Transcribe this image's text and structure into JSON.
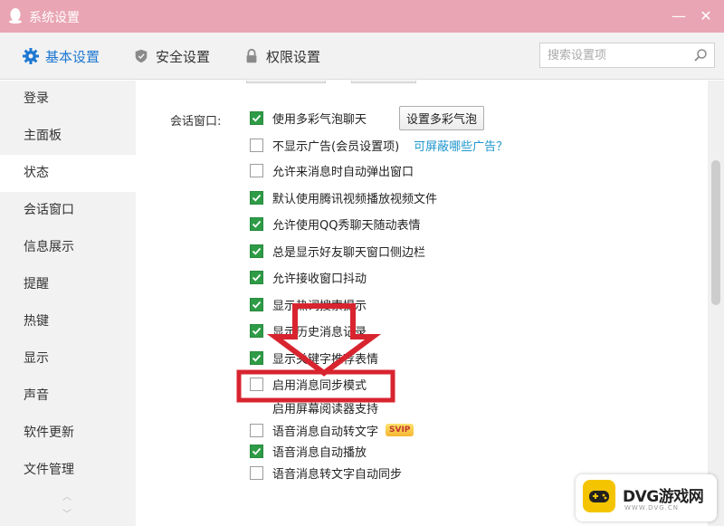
{
  "window": {
    "title": "系统设置",
    "minimize_glyph": "—",
    "close_glyph": "✕"
  },
  "tabs": [
    {
      "label": "基本设置",
      "icon": "gear-icon",
      "active": true
    },
    {
      "label": "安全设置",
      "icon": "shield-icon",
      "active": false
    },
    {
      "label": "权限设置",
      "icon": "lock-icon",
      "active": false
    }
  ],
  "search": {
    "placeholder": "搜索设置项",
    "value": ""
  },
  "sidebar": {
    "items": [
      {
        "label": "登录"
      },
      {
        "label": "主面板"
      },
      {
        "label": "状态",
        "active": true
      },
      {
        "label": "会话窗口"
      },
      {
        "label": "信息展示"
      },
      {
        "label": "提醒"
      },
      {
        "label": "热键"
      },
      {
        "label": "显示"
      },
      {
        "label": "声音"
      },
      {
        "label": "软件更新"
      },
      {
        "label": "文件管理"
      }
    ],
    "scroll_up_glyph": "︿",
    "scroll_down_glyph": "﹀"
  },
  "section": {
    "label": "会话窗口:",
    "button": "设置多彩气泡",
    "link": "可屏蔽哪些广告？",
    "badge": "SVIP",
    "options": [
      {
        "label": "使用多彩气泡聊天",
        "checked": true
      },
      {
        "label": "不显示广告(会员设置项)",
        "checked": false
      },
      {
        "label": "允许来消息时自动弹出窗口",
        "checked": false
      },
      {
        "label": "默认使用腾讯视频播放视频文件",
        "checked": true
      },
      {
        "label": "允许使用QQ秀聊天随动表情",
        "checked": true
      },
      {
        "label": "总是显示好友聊天窗口侧边栏",
        "checked": true
      },
      {
        "label": "允许接收窗口抖动",
        "checked": true
      },
      {
        "label": "显示热词搜索提示",
        "checked": true
      },
      {
        "label": "显示历史消息记录",
        "checked": true
      },
      {
        "label": "显示关键字推荐表情",
        "checked": true
      },
      {
        "label": "启用消息同步模式",
        "checked": false
      },
      {
        "label": "启用屏幕阅读器支持",
        "checked": false
      },
      {
        "label": "语音消息自动转文字",
        "checked": false
      },
      {
        "label": "语音消息自动播放",
        "checked": true
      },
      {
        "label": "语音消息转文字自动同步",
        "checked": false
      }
    ]
  },
  "annotation": {
    "color": "#d8242f"
  },
  "watermark": {
    "brand": "DVG游戏网",
    "sub": "WWW.DVG.CN"
  },
  "colors": {
    "titlebar": "#e9a5b3",
    "accent": "#1e78d2",
    "check": "#2e9b46",
    "link": "#1e96cc"
  }
}
